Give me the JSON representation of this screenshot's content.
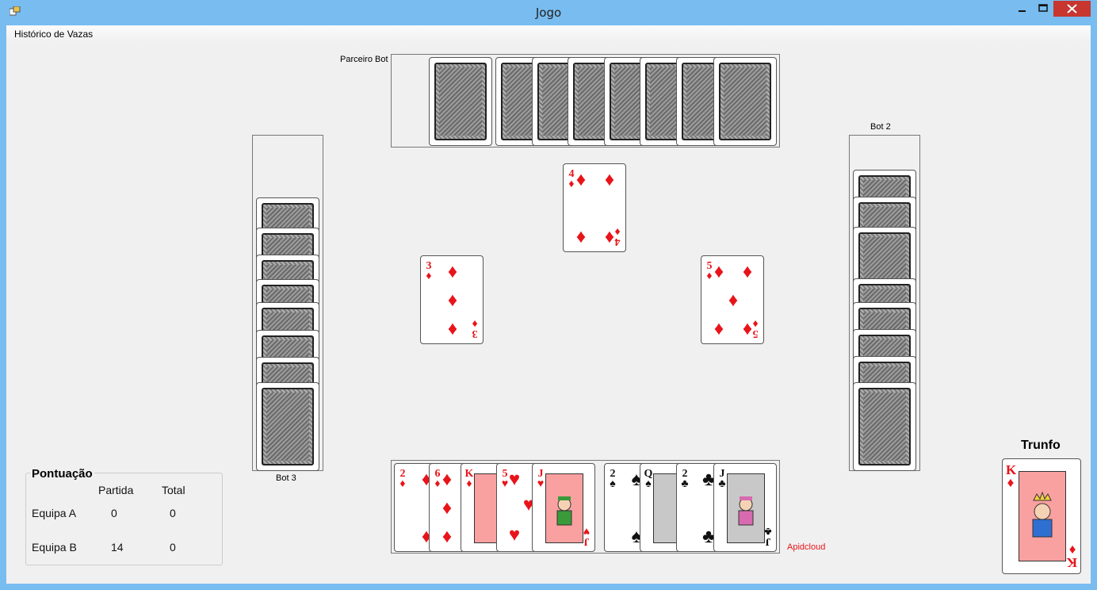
{
  "window": {
    "title": "Jogo"
  },
  "menu": {
    "items": [
      {
        "label": "Histórico de Vazas"
      }
    ]
  },
  "players": {
    "partner": {
      "label": "Parceiro Bot",
      "hidden_cards": 8
    },
    "bot2": {
      "label": "Bot 2",
      "hidden_cards": 8
    },
    "bot3": {
      "label": "Bot 3",
      "hidden_cards": 8
    },
    "player_tag": "Apidcloud"
  },
  "table": {
    "played": [
      {
        "position": "top",
        "rank": "4",
        "suit": "♦",
        "color": "#e8141a"
      },
      {
        "position": "left",
        "rank": "3",
        "suit": "♦",
        "color": "#e8141a"
      },
      {
        "position": "right",
        "rank": "5",
        "suit": "♦",
        "color": "#e8141a"
      }
    ]
  },
  "hand": [
    {
      "rank": "2",
      "suit": "♦"
    },
    {
      "rank": "6",
      "suit": "♦"
    },
    {
      "rank": "K",
      "suit": "♦"
    },
    {
      "rank": "5",
      "suit": "♥"
    },
    {
      "rank": "J",
      "suit": "♥"
    },
    {
      "rank": "2",
      "suit": "♠"
    },
    {
      "rank": "Q",
      "suit": "♠"
    },
    {
      "rank": "2",
      "suit": "♣"
    },
    {
      "rank": "J",
      "suit": "♣"
    }
  ],
  "score": {
    "title": "Pontuação",
    "headers": [
      "Partida",
      "Total"
    ],
    "rows": [
      {
        "team": "Equipa A",
        "partida": "0",
        "total": "0"
      },
      {
        "team": "Equipa B",
        "partida": "14",
        "total": "0"
      }
    ]
  },
  "trump": {
    "label": "Trunfo",
    "rank": "K",
    "suit": "♦"
  }
}
